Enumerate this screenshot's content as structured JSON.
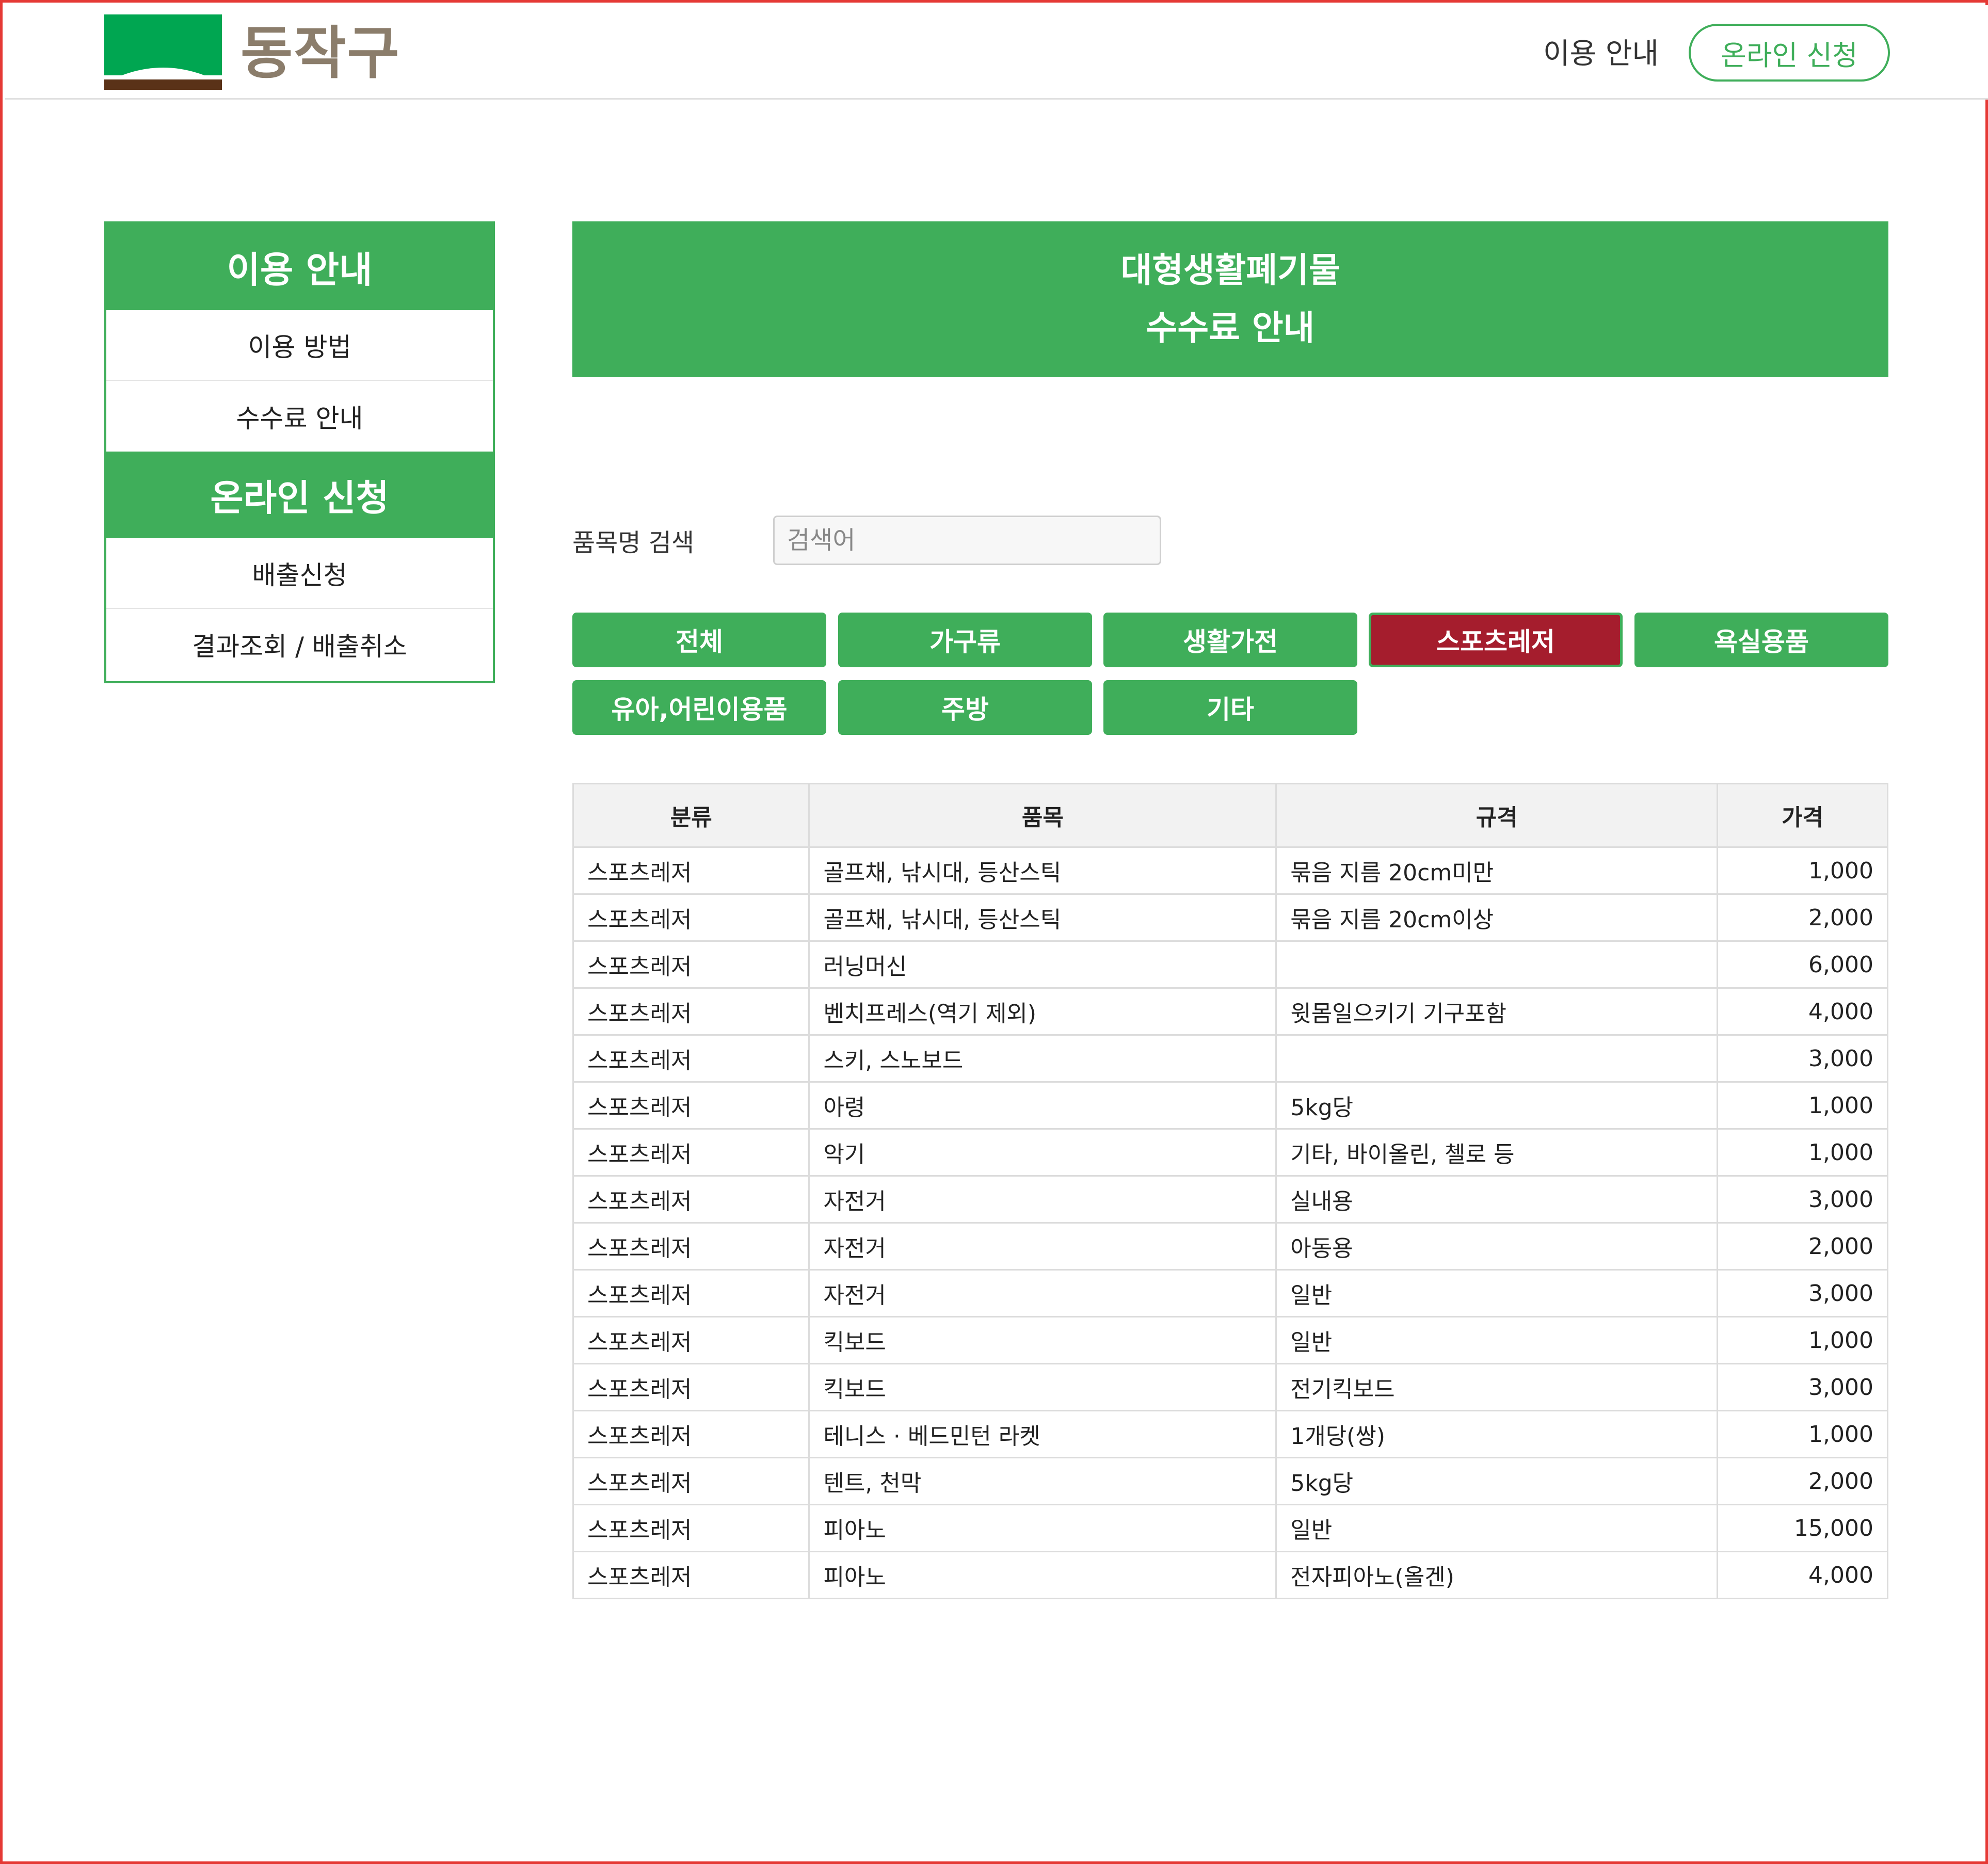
{
  "header": {
    "logo_text": "동작구",
    "nav_guide": "이용 안내",
    "apply_button": "온라인 신청",
    "logo_colors": {
      "roof": "#00a651",
      "base": "#5a3218"
    }
  },
  "sidebar": {
    "sections": [
      {
        "title": "이용 안내",
        "items": [
          "이용 방법",
          "수수료 안내"
        ]
      },
      {
        "title": "온라인 신청",
        "items": [
          "배출신청",
          "결과조회 / 배출취소"
        ]
      }
    ]
  },
  "banner": {
    "line1": "대형생활폐기물",
    "line2": "수수료 안내"
  },
  "search": {
    "label": "품목명 검색",
    "placeholder": "검색어",
    "value": ""
  },
  "categories": {
    "items": [
      "전체",
      "가구류",
      "생활가전",
      "스포츠레저",
      "욕실용품",
      "유아,어린이용품",
      "주방",
      "기타"
    ],
    "active": "스포츠레저"
  },
  "table": {
    "headers": [
      "분류",
      "품목",
      "규격",
      "가격"
    ],
    "rows": [
      [
        "스포츠레저",
        "골프채, 낚시대, 등산스틱",
        "묶음 지름 20cm미만",
        "1,000"
      ],
      [
        "스포츠레저",
        "골프채, 낚시대, 등산스틱",
        "묶음 지름 20cm이상",
        "2,000"
      ],
      [
        "스포츠레저",
        "러닝머신",
        "",
        "6,000"
      ],
      [
        "스포츠레저",
        "벤치프레스(역기 제외)",
        "윗몸일으키기 기구포함",
        "4,000"
      ],
      [
        "스포츠레저",
        "스키, 스노보드",
        "",
        "3,000"
      ],
      [
        "스포츠레저",
        "아령",
        "5kg당",
        "1,000"
      ],
      [
        "스포츠레저",
        "악기",
        "기타, 바이올린, 첼로 등",
        "1,000"
      ],
      [
        "스포츠레저",
        "자전거",
        "실내용",
        "3,000"
      ],
      [
        "스포츠레저",
        "자전거",
        "아동용",
        "2,000"
      ],
      [
        "스포츠레저",
        "자전거",
        "일반",
        "3,000"
      ],
      [
        "스포츠레저",
        "킥보드",
        "일반",
        "1,000"
      ],
      [
        "스포츠레저",
        "킥보드",
        "전기킥보드",
        "3,000"
      ],
      [
        "스포츠레저",
        "테니스 · 베드민턴 라켓",
        "1개당(쌍)",
        "1,000"
      ],
      [
        "스포츠레저",
        "텐트, 천막",
        "5kg당",
        "2,000"
      ],
      [
        "스포츠레저",
        "피아노",
        "일반",
        "15,000"
      ],
      [
        "스포츠레저",
        "피아노",
        "전자피아노(올겐)",
        "4,000"
      ]
    ]
  },
  "colors": {
    "accent": "#3fae5a",
    "active_category": "#a51d2d",
    "frame_border": "#e53935"
  }
}
